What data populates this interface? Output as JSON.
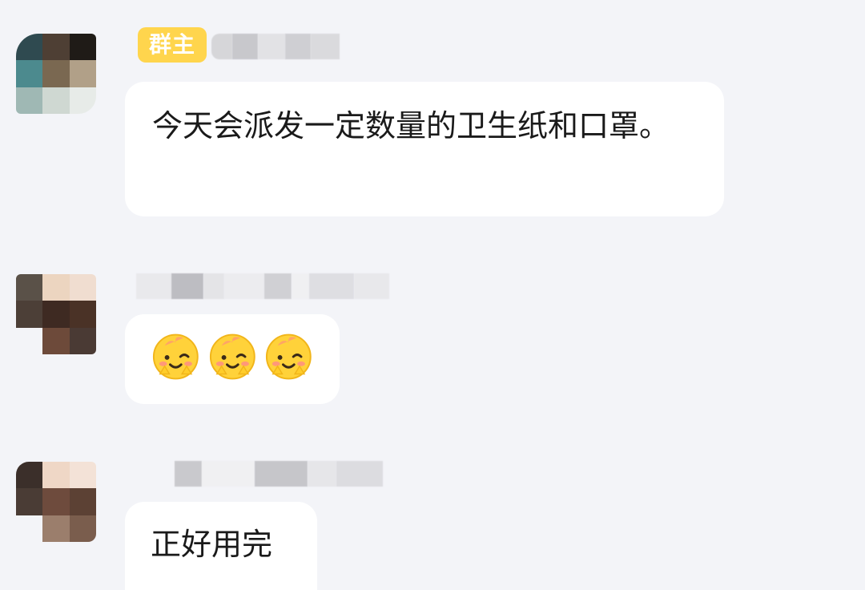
{
  "chat": {
    "messages": [
      {
        "badge": "群主",
        "text": "今天会派发一定数量的卫生纸和口罩。"
      },
      {
        "emoji_count": 3,
        "emoji_icon": "smiling-blush-emoji-icon"
      },
      {
        "text": "正好用完"
      }
    ]
  },
  "colors": {
    "background": "#f3f4f8",
    "bubble": "#ffffff",
    "badge": "#ffd54d",
    "text": "#1a1a1a"
  }
}
